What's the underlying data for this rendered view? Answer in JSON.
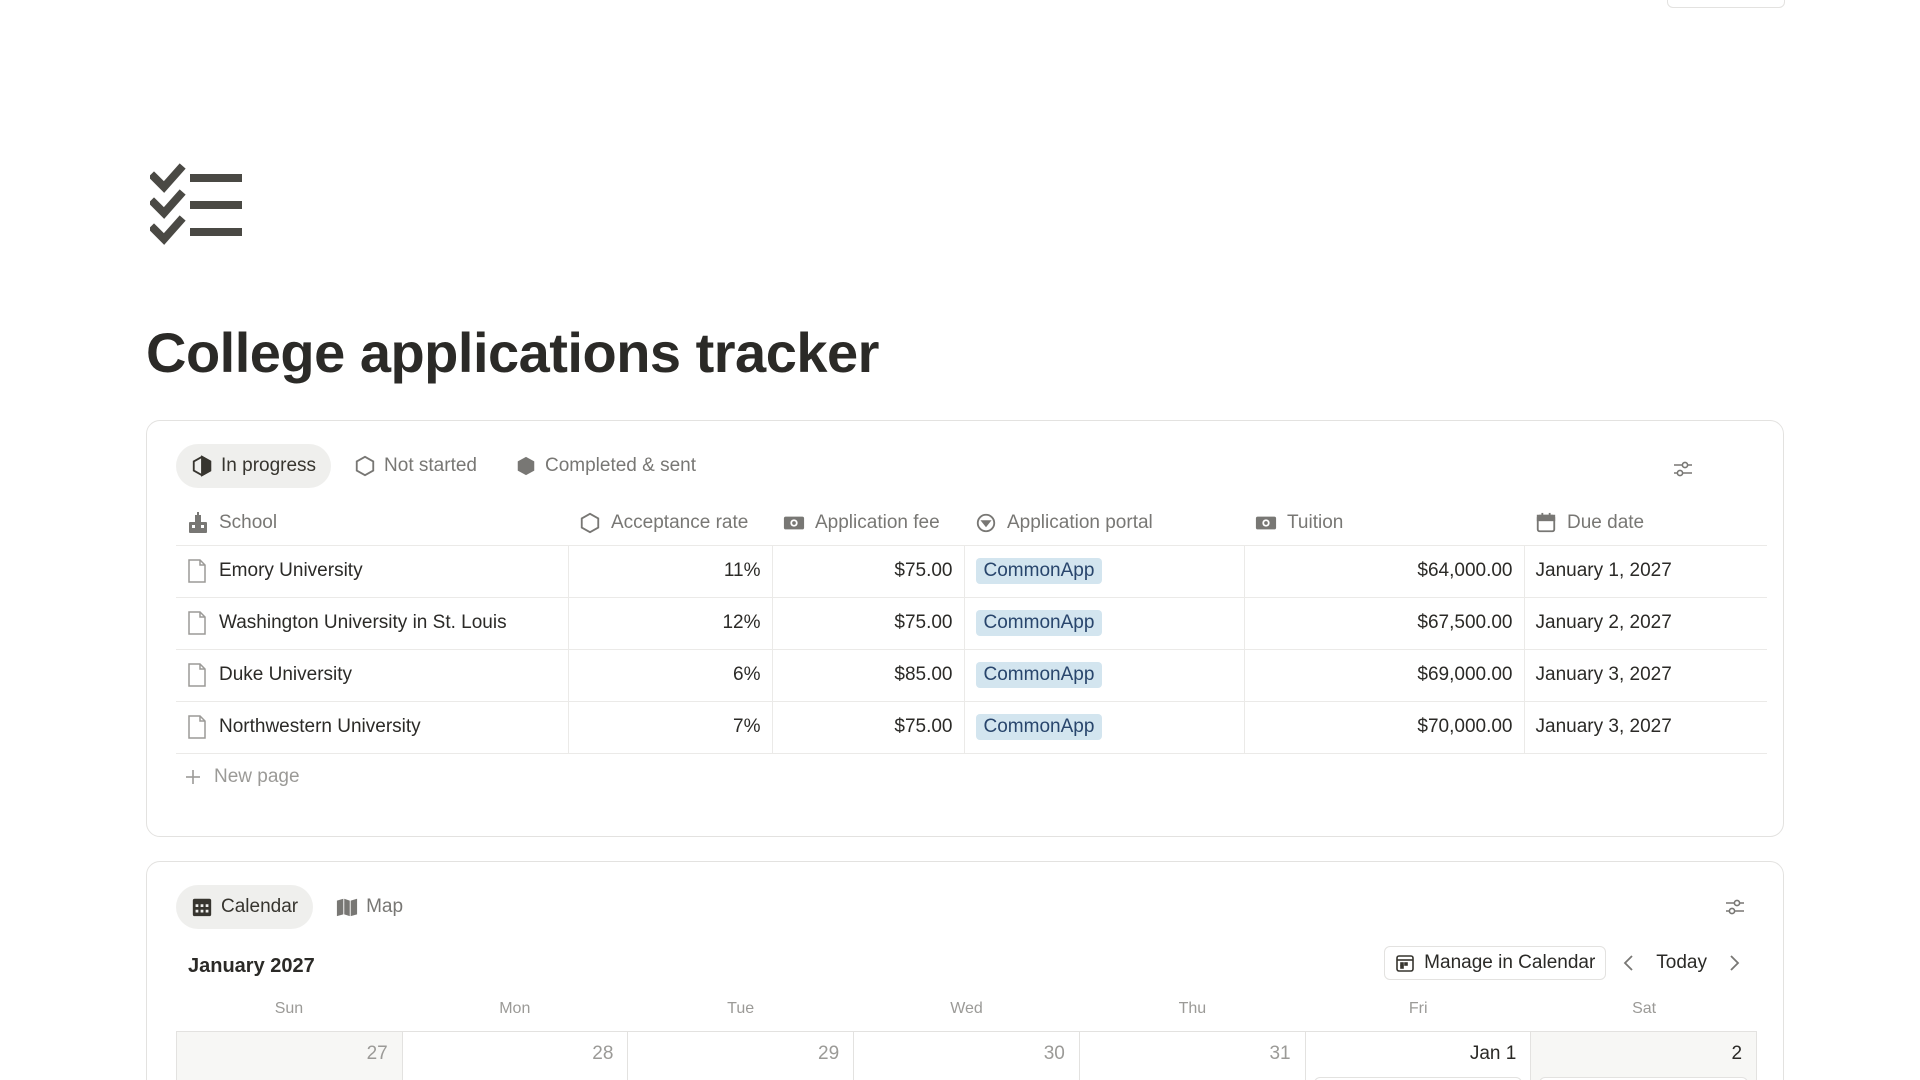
{
  "page": {
    "title": "College applications tracker",
    "icon": "checklist-icon"
  },
  "database": {
    "views": [
      {
        "label": "In progress",
        "icon": "status-in-progress-icon",
        "active": true
      },
      {
        "label": "Not started",
        "icon": "status-not-started-icon",
        "active": false
      },
      {
        "label": "Completed & sent",
        "icon": "status-completed-icon",
        "active": false
      }
    ],
    "columns": [
      {
        "label": "School",
        "icon": "building-icon"
      },
      {
        "label": "Acceptance rate",
        "icon": "hexagon-icon"
      },
      {
        "label": "Application fee",
        "icon": "money-icon"
      },
      {
        "label": "Application portal",
        "icon": "select-icon"
      },
      {
        "label": "Tuition",
        "icon": "money-icon"
      },
      {
        "label": "Due date",
        "icon": "calendar-icon"
      }
    ],
    "rows": [
      {
        "school": "Emory University",
        "acceptance_rate": "11%",
        "application_fee": "$75.00",
        "portal": "CommonApp",
        "tuition": "$64,000.00",
        "due_date": "January 1, 2027"
      },
      {
        "school": "Washington University in St. Louis",
        "acceptance_rate": "12%",
        "application_fee": "$75.00",
        "portal": "CommonApp",
        "tuition": "$67,500.00",
        "due_date": "January 2, 2027"
      },
      {
        "school": "Duke University",
        "acceptance_rate": "6%",
        "application_fee": "$85.00",
        "portal": "CommonApp",
        "tuition": "$69,000.00",
        "due_date": "January 3, 2027"
      },
      {
        "school": "Northwestern University",
        "acceptance_rate": "7%",
        "application_fee": "$75.00",
        "portal": "CommonApp",
        "tuition": "$70,000.00",
        "due_date": "January 3, 2027"
      }
    ],
    "new_page_label": "New page",
    "tag_colors": {
      "background": "#d3e5ef",
      "text": "#28456c"
    }
  },
  "calendar": {
    "views": [
      {
        "label": "Calendar",
        "icon": "calendar-grid-icon",
        "active": true
      },
      {
        "label": "Map",
        "icon": "map-icon",
        "active": false
      }
    ],
    "month": "January 2027",
    "manage_label": "Manage in Calendar",
    "today_label": "Today",
    "weekdays": [
      "Sun",
      "Mon",
      "Tue",
      "Wed",
      "Thu",
      "Fri",
      "Sat"
    ],
    "days": [
      "27",
      "28",
      "29",
      "30",
      "31",
      "Jan 1",
      "2"
    ]
  }
}
